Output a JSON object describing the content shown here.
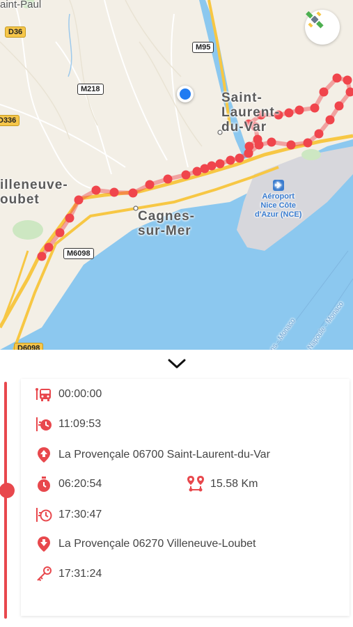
{
  "map": {
    "labels": {
      "saint_paul": "aint-Paul",
      "saint_laurent": "Saint-\nLaurent-\ndu-Var",
      "villeneuve": "illeneuve-\noubet",
      "cagnes": "Cagnes-\nsur-Mer",
      "airport": "Aéroport\nNice Côte\nd'Azur (NCE)",
      "sea_label_1": "ns - Monaco",
      "sea_label_2": "Napoule - Monaco"
    },
    "roads": {
      "d36": "D36",
      "m95": "M95",
      "m218": "M218",
      "d336": "D336",
      "m6098": "M6098",
      "d6098": "D6098"
    },
    "colors": {
      "route": "#f0454c",
      "water": "#8cc8ef",
      "land": "#f3efe6",
      "highway": "#f7c744",
      "current_location": "#1f7bf2"
    }
  },
  "trip": {
    "start_time": "00:00:00",
    "departure_time": "11:09:53",
    "start_address": "La Provençale 06700 Saint-Laurent-du-Var",
    "duration": "06:20:54",
    "distance": "15.58 Km",
    "arrival_time": "17:30:47",
    "end_address": "La Provençale 06270 Villeneuve-Loubet",
    "key_off_time": "17:31:24"
  },
  "icons": {
    "start": "bus-stop-icon",
    "departure": "departure-clock-icon",
    "start_address": "pin-up-icon",
    "duration": "stopwatch-icon",
    "distance": "route-pins-icon",
    "arrival": "arrival-clock-icon",
    "end_address": "pin-down-icon",
    "key": "key-icon"
  },
  "accent": "#e8484d"
}
